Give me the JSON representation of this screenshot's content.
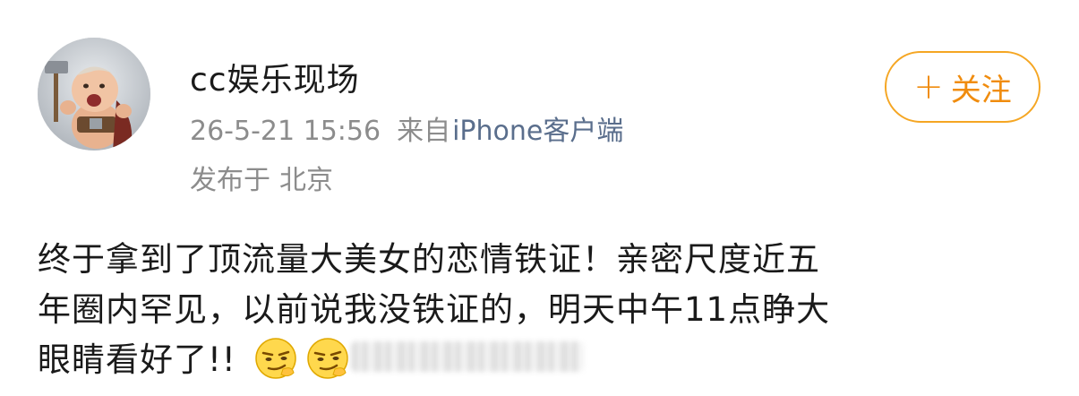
{
  "user": {
    "name": "cc娱乐现场",
    "avatar_icon": "avatar-baby-warrior-icon"
  },
  "meta": {
    "time": "26-5-21 15:56",
    "source_prefix": "来自",
    "source_device": "iPhone客户端",
    "location_prefix": "发布于",
    "location": "北京"
  },
  "follow_button": {
    "plus": "+",
    "label": "关注",
    "color": "#f5a623"
  },
  "post": {
    "lines": [
      "终于拿到了顶流量大美女的恋情铁证！亲密尺度近五",
      "年圈内罕见，以前说我没铁证的，明天中午11点睁大",
      "眼睛看好了!!"
    ],
    "emojis": [
      "smirk-emoji-icon",
      "smirk-emoji-icon"
    ]
  }
}
